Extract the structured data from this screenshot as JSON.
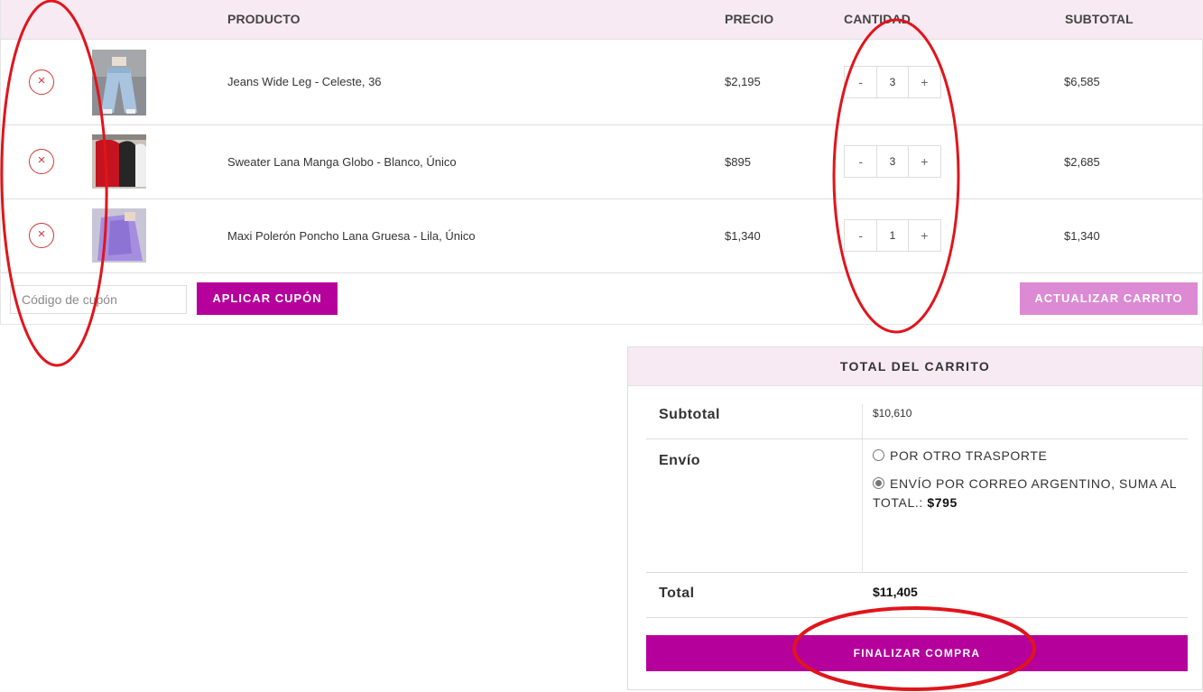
{
  "table": {
    "headers": {
      "product": "PRODUCTO",
      "price": "PRECIO",
      "quantity": "CANTIDAD",
      "subtotal": "SUBTOTAL"
    },
    "remove_symbol": "×",
    "minus_symbol": "-",
    "plus_symbol": "+",
    "rows": [
      {
        "name": "Jeans Wide Leg - Celeste, 36",
        "price": "$2,195",
        "qty": "3",
        "subtotal": "$6,585"
      },
      {
        "name": "Sweater Lana Manga Globo - Blanco, Único",
        "price": "$895",
        "qty": "3",
        "subtotal": "$2,685"
      },
      {
        "name": "Maxi Polerón Poncho Lana Gruesa - Lila, Único",
        "price": "$1,340",
        "qty": "1",
        "subtotal": "$1,340"
      }
    ]
  },
  "coupon": {
    "placeholder": "Código de cupón",
    "apply_label": "APLICAR CUPÓN"
  },
  "update_label": "ACTUALIZAR CARRITO",
  "totals": {
    "heading": "TOTAL DEL CARRITO",
    "subtotal_label": "Subtotal",
    "subtotal_value": "$10,610",
    "shipping_label": "Envío",
    "shipping_options": [
      {
        "label": "POR OTRO TRASPORTE",
        "selected": false
      },
      {
        "label": "ENVÍO POR CORREO ARGENTINO, SUMA AL TOTAL.:",
        "price": "$795",
        "selected": true
      }
    ],
    "total_label": "Total",
    "total_value": "$11,405",
    "checkout_label": "FINALIZAR COMPRA"
  },
  "colors": {
    "accent": "#b5009b",
    "accent_light": "#dc8ad3",
    "header_bg": "#f7eaf2",
    "annotation": "#e0151c"
  }
}
